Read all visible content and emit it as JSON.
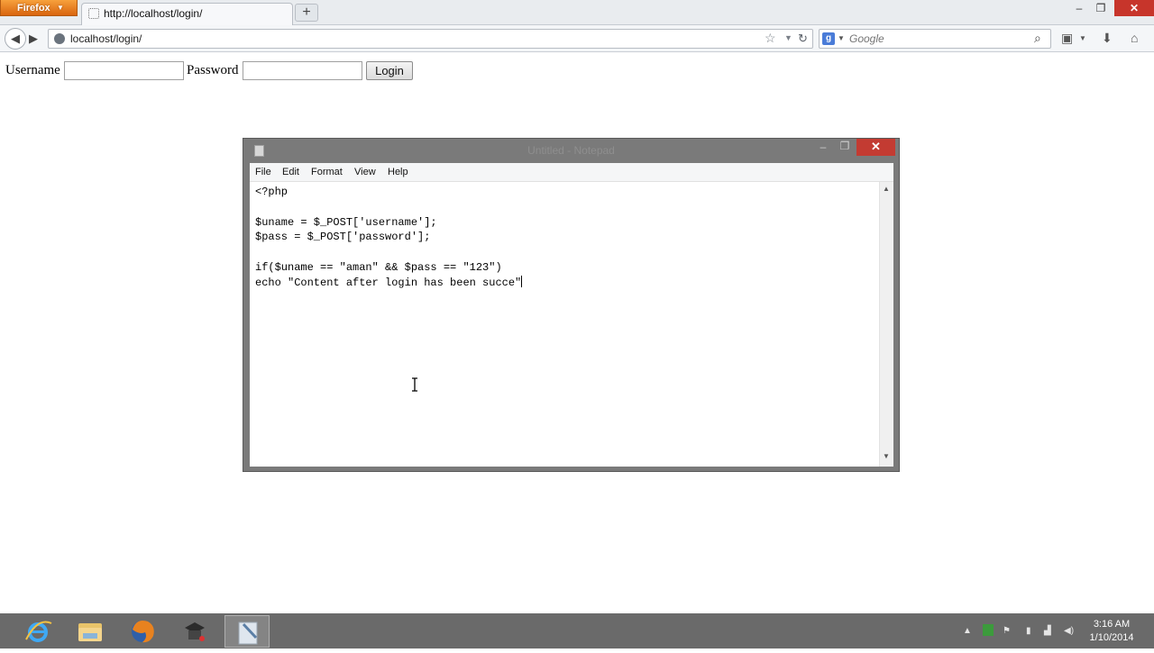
{
  "browser": {
    "menu_button": "Firefox",
    "tab_title": "http://localhost/login/",
    "url": "localhost/login/",
    "search_engine": "Google",
    "window_controls": {
      "minimize": "–",
      "maximize": "❐",
      "close": "✕"
    }
  },
  "login_form": {
    "username_label": "Username",
    "username_value": "",
    "password_label": "Password",
    "password_value": "",
    "submit_label": "Login"
  },
  "notepad": {
    "title": "Untitled - Notepad",
    "menu": [
      "File",
      "Edit",
      "Format",
      "View",
      "Help"
    ],
    "code": "<?php\n\n$uname = $_POST['username'];\n$pass = $_POST['password'];\n\nif($uname == \"aman\" && $pass == \"123\")\necho \"Content after login has been succe\""
  },
  "taskbar": {
    "clock_time": "3:16 AM",
    "clock_date": "1/10/2014"
  },
  "colors": {
    "firefox_orange": "#e8821f",
    "close_red": "#c7352b",
    "taskbar_gray": "#6a6a6a"
  }
}
